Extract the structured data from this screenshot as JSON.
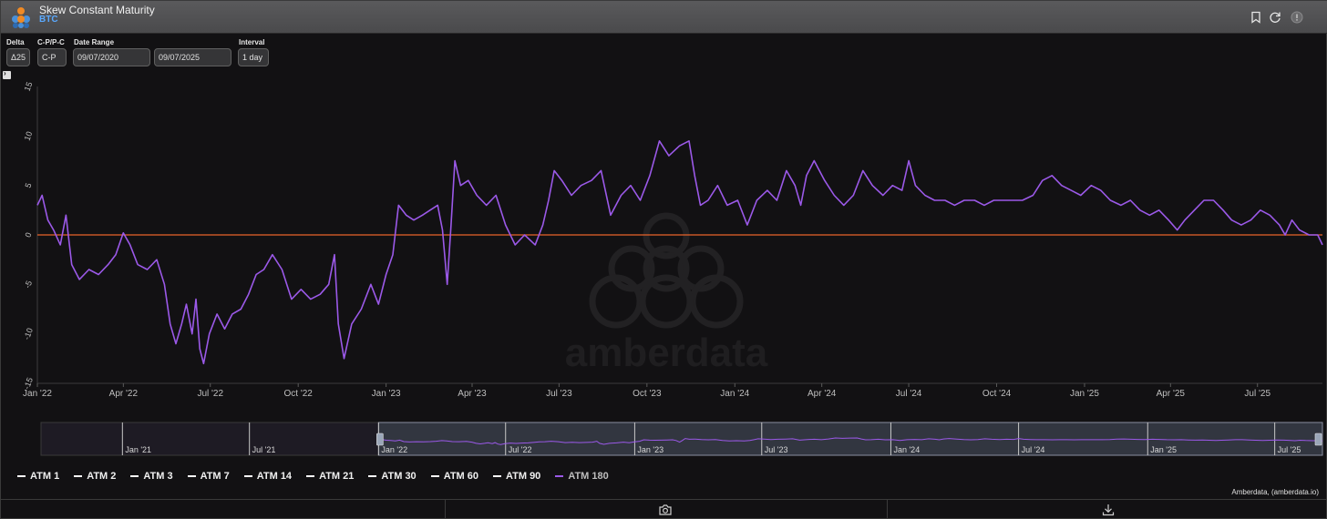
{
  "header": {
    "title": "Skew Constant Maturity",
    "subtitle": "BTC"
  },
  "controls": {
    "delta_label": "Delta",
    "delta_value": "Δ25",
    "type_label": "C-P/P-C",
    "type_value": "C-P",
    "date_range_label": "Date Range",
    "date_start": "09/07/2020",
    "date_end": "09/07/2025",
    "interval_label": "Interval",
    "interval_value": "1 day"
  },
  "legend": [
    {
      "label": "ATM 1",
      "color": "#ffffff",
      "active": false
    },
    {
      "label": "ATM 2",
      "color": "#ffffff",
      "active": false
    },
    {
      "label": "ATM 3",
      "color": "#ffffff",
      "active": false
    },
    {
      "label": "ATM 7",
      "color": "#ffffff",
      "active": false
    },
    {
      "label": "ATM 14",
      "color": "#ffffff",
      "active": false
    },
    {
      "label": "ATM 21",
      "color": "#ffffff",
      "active": false
    },
    {
      "label": "ATM 30",
      "color": "#ffffff",
      "active": false
    },
    {
      "label": "ATM 60",
      "color": "#ffffff",
      "active": false
    },
    {
      "label": "ATM 90",
      "color": "#ffffff",
      "active": false
    },
    {
      "label": "ATM 180",
      "color": "#9b59e8",
      "active": true
    }
  ],
  "credit": "Amberdata, (amberdata.io)",
  "watermark": "amberdata",
  "colors": {
    "series": "#9b59e8",
    "zero_line": "#e8642a",
    "axis_text": "#bfbfbf"
  },
  "chart_data": {
    "type": "line",
    "series_name": "ATM 180",
    "ylim": [
      -15,
      15
    ],
    "yticks": [
      15,
      10,
      5,
      0,
      -5,
      -10,
      -15
    ],
    "ytick_labels": [
      "15",
      "10",
      "5",
      "0",
      "-5",
      "-10",
      "-15"
    ],
    "xlim": [
      "2022-01-01",
      "2025-09-07"
    ],
    "xticks": [
      {
        "date": "2022-01-01",
        "label": "Jan '22"
      },
      {
        "date": "2022-04-01",
        "label": "Apr '22"
      },
      {
        "date": "2022-07-01",
        "label": "Jul '22"
      },
      {
        "date": "2022-10-01",
        "label": "Oct '22"
      },
      {
        "date": "2023-01-01",
        "label": "Jan '23"
      },
      {
        "date": "2023-04-01",
        "label": "Apr '23"
      },
      {
        "date": "2023-07-01",
        "label": "Jul '23"
      },
      {
        "date": "2023-10-01",
        "label": "Oct '23"
      },
      {
        "date": "2024-01-01",
        "label": "Jan '24"
      },
      {
        "date": "2024-04-01",
        "label": "Apr '24"
      },
      {
        "date": "2024-07-01",
        "label": "Jul '24"
      },
      {
        "date": "2024-10-01",
        "label": "Oct '24"
      },
      {
        "date": "2025-01-01",
        "label": "Jan '25"
      },
      {
        "date": "2025-04-01",
        "label": "Apr '25"
      },
      {
        "date": "2025-07-01",
        "label": "Jul '25"
      }
    ],
    "zero_line": 0,
    "points": [
      [
        "2022-01-01",
        3.0
      ],
      [
        "2022-01-06",
        4.0
      ],
      [
        "2022-01-12",
        1.5
      ],
      [
        "2022-01-18",
        0.5
      ],
      [
        "2022-01-25",
        -1.0
      ],
      [
        "2022-01-31",
        2.0
      ],
      [
        "2022-02-06",
        -3.0
      ],
      [
        "2022-02-14",
        -4.5
      ],
      [
        "2022-02-24",
        -3.5
      ],
      [
        "2022-03-06",
        -4.0
      ],
      [
        "2022-03-16",
        -3.0
      ],
      [
        "2022-03-24",
        -2.0
      ],
      [
        "2022-04-01",
        0.2
      ],
      [
        "2022-04-08",
        -1.0
      ],
      [
        "2022-04-16",
        -3.0
      ],
      [
        "2022-04-26",
        -3.5
      ],
      [
        "2022-05-06",
        -2.5
      ],
      [
        "2022-05-14",
        -5.0
      ],
      [
        "2022-05-20",
        -9.0
      ],
      [
        "2022-05-26",
        -11.0
      ],
      [
        "2022-06-01",
        -9.0
      ],
      [
        "2022-06-06",
        -7.0
      ],
      [
        "2022-06-12",
        -10.0
      ],
      [
        "2022-06-16",
        -6.5
      ],
      [
        "2022-06-20",
        -11.5
      ],
      [
        "2022-06-24",
        -13.0
      ],
      [
        "2022-06-30",
        -10.0
      ],
      [
        "2022-07-08",
        -8.0
      ],
      [
        "2022-07-16",
        -9.5
      ],
      [
        "2022-07-24",
        -8.0
      ],
      [
        "2022-08-02",
        -7.5
      ],
      [
        "2022-08-10",
        -6.0
      ],
      [
        "2022-08-18",
        -4.0
      ],
      [
        "2022-08-26",
        -3.5
      ],
      [
        "2022-09-04",
        -2.0
      ],
      [
        "2022-09-14",
        -3.5
      ],
      [
        "2022-09-24",
        -6.5
      ],
      [
        "2022-10-04",
        -5.5
      ],
      [
        "2022-10-14",
        -6.5
      ],
      [
        "2022-10-24",
        -6.0
      ],
      [
        "2022-11-02",
        -5.0
      ],
      [
        "2022-11-08",
        -2.0
      ],
      [
        "2022-11-12",
        -9.0
      ],
      [
        "2022-11-18",
        -12.5
      ],
      [
        "2022-11-26",
        -9.0
      ],
      [
        "2022-12-06",
        -7.5
      ],
      [
        "2022-12-16",
        -5.0
      ],
      [
        "2022-12-24",
        -7.0
      ],
      [
        "2023-01-01",
        -4.0
      ],
      [
        "2023-01-08",
        -2.0
      ],
      [
        "2023-01-14",
        3.0
      ],
      [
        "2023-01-22",
        2.0
      ],
      [
        "2023-01-30",
        1.5
      ],
      [
        "2023-02-08",
        2.0
      ],
      [
        "2023-02-16",
        2.5
      ],
      [
        "2023-02-24",
        3.0
      ],
      [
        "2023-03-01",
        0.5
      ],
      [
        "2023-03-06",
        -5.0
      ],
      [
        "2023-03-10",
        1.0
      ],
      [
        "2023-03-14",
        7.5
      ],
      [
        "2023-03-20",
        5.0
      ],
      [
        "2023-03-28",
        5.5
      ],
      [
        "2023-04-06",
        4.0
      ],
      [
        "2023-04-16",
        3.0
      ],
      [
        "2023-04-26",
        4.0
      ],
      [
        "2023-05-06",
        1.0
      ],
      [
        "2023-05-16",
        -1.0
      ],
      [
        "2023-05-26",
        0.0
      ],
      [
        "2023-06-06",
        -1.0
      ],
      [
        "2023-06-14",
        1.0
      ],
      [
        "2023-06-20",
        3.5
      ],
      [
        "2023-06-26",
        6.5
      ],
      [
        "2023-07-04",
        5.5
      ],
      [
        "2023-07-14",
        4.0
      ],
      [
        "2023-07-24",
        5.0
      ],
      [
        "2023-08-04",
        5.5
      ],
      [
        "2023-08-14",
        6.5
      ],
      [
        "2023-08-24",
        2.0
      ],
      [
        "2023-09-04",
        4.0
      ],
      [
        "2023-09-14",
        5.0
      ],
      [
        "2023-09-24",
        3.5
      ],
      [
        "2023-10-04",
        6.0
      ],
      [
        "2023-10-14",
        9.5
      ],
      [
        "2023-10-24",
        8.0
      ],
      [
        "2023-11-04",
        9.0
      ],
      [
        "2023-11-14",
        9.5
      ],
      [
        "2023-11-20",
        6.0
      ],
      [
        "2023-11-26",
        3.0
      ],
      [
        "2023-12-04",
        3.5
      ],
      [
        "2023-12-14",
        5.0
      ],
      [
        "2023-12-24",
        3.0
      ],
      [
        "2024-01-04",
        3.5
      ],
      [
        "2024-01-14",
        1.0
      ],
      [
        "2024-01-24",
        3.5
      ],
      [
        "2024-02-04",
        4.5
      ],
      [
        "2024-02-14",
        3.5
      ],
      [
        "2024-02-24",
        6.5
      ],
      [
        "2024-03-04",
        5.0
      ],
      [
        "2024-03-10",
        3.0
      ],
      [
        "2024-03-16",
        6.0
      ],
      [
        "2024-03-24",
        7.5
      ],
      [
        "2024-04-04",
        5.5
      ],
      [
        "2024-04-14",
        4.0
      ],
      [
        "2024-04-24",
        3.0
      ],
      [
        "2024-05-04",
        4.0
      ],
      [
        "2024-05-14",
        6.5
      ],
      [
        "2024-05-24",
        5.0
      ],
      [
        "2024-06-04",
        4.0
      ],
      [
        "2024-06-14",
        5.0
      ],
      [
        "2024-06-24",
        4.5
      ],
      [
        "2024-07-01",
        7.5
      ],
      [
        "2024-07-08",
        5.0
      ],
      [
        "2024-07-18",
        4.0
      ],
      [
        "2024-07-28",
        3.5
      ],
      [
        "2024-08-08",
        3.5
      ],
      [
        "2024-08-18",
        3.0
      ],
      [
        "2024-08-28",
        3.5
      ],
      [
        "2024-09-08",
        3.5
      ],
      [
        "2024-09-18",
        3.0
      ],
      [
        "2024-09-28",
        3.5
      ],
      [
        "2024-10-08",
        3.5
      ],
      [
        "2024-10-18",
        3.5
      ],
      [
        "2024-10-28",
        3.5
      ],
      [
        "2024-11-08",
        4.0
      ],
      [
        "2024-11-18",
        5.5
      ],
      [
        "2024-11-28",
        6.0
      ],
      [
        "2024-12-08",
        5.0
      ],
      [
        "2024-12-18",
        4.5
      ],
      [
        "2024-12-28",
        4.0
      ],
      [
        "2025-01-08",
        5.0
      ],
      [
        "2025-01-18",
        4.5
      ],
      [
        "2025-01-28",
        3.5
      ],
      [
        "2025-02-08",
        3.0
      ],
      [
        "2025-02-18",
        3.5
      ],
      [
        "2025-02-28",
        2.5
      ],
      [
        "2025-03-10",
        2.0
      ],
      [
        "2025-03-20",
        2.5
      ],
      [
        "2025-03-30",
        1.5
      ],
      [
        "2025-04-08",
        0.5
      ],
      [
        "2025-04-16",
        1.5
      ],
      [
        "2025-04-26",
        2.5
      ],
      [
        "2025-05-06",
        3.5
      ],
      [
        "2025-05-16",
        3.5
      ],
      [
        "2025-05-26",
        2.5
      ],
      [
        "2025-06-04",
        1.5
      ],
      [
        "2025-06-14",
        1.0
      ],
      [
        "2025-06-24",
        1.5
      ],
      [
        "2025-07-04",
        2.5
      ],
      [
        "2025-07-14",
        2.0
      ],
      [
        "2025-07-24",
        1.0
      ],
      [
        "2025-07-30",
        0.0
      ],
      [
        "2025-08-06",
        1.5
      ],
      [
        "2025-08-14",
        0.5
      ],
      [
        "2025-08-24",
        0.0
      ],
      [
        "2025-09-02",
        0.0
      ],
      [
        "2025-09-07",
        -1.0
      ]
    ]
  },
  "navigator": {
    "xticks": [
      "Jan '21",
      "Jul '21",
      "Jan '22",
      "Jul '22",
      "Jan '23",
      "Jul '23",
      "Jan '24",
      "Jul '24",
      "Jan '25",
      "Jul '25"
    ],
    "selection_start": "2022-01-01",
    "selection_end": "2025-09-07",
    "range_start": "2020-09-07",
    "range_end": "2025-09-07"
  }
}
